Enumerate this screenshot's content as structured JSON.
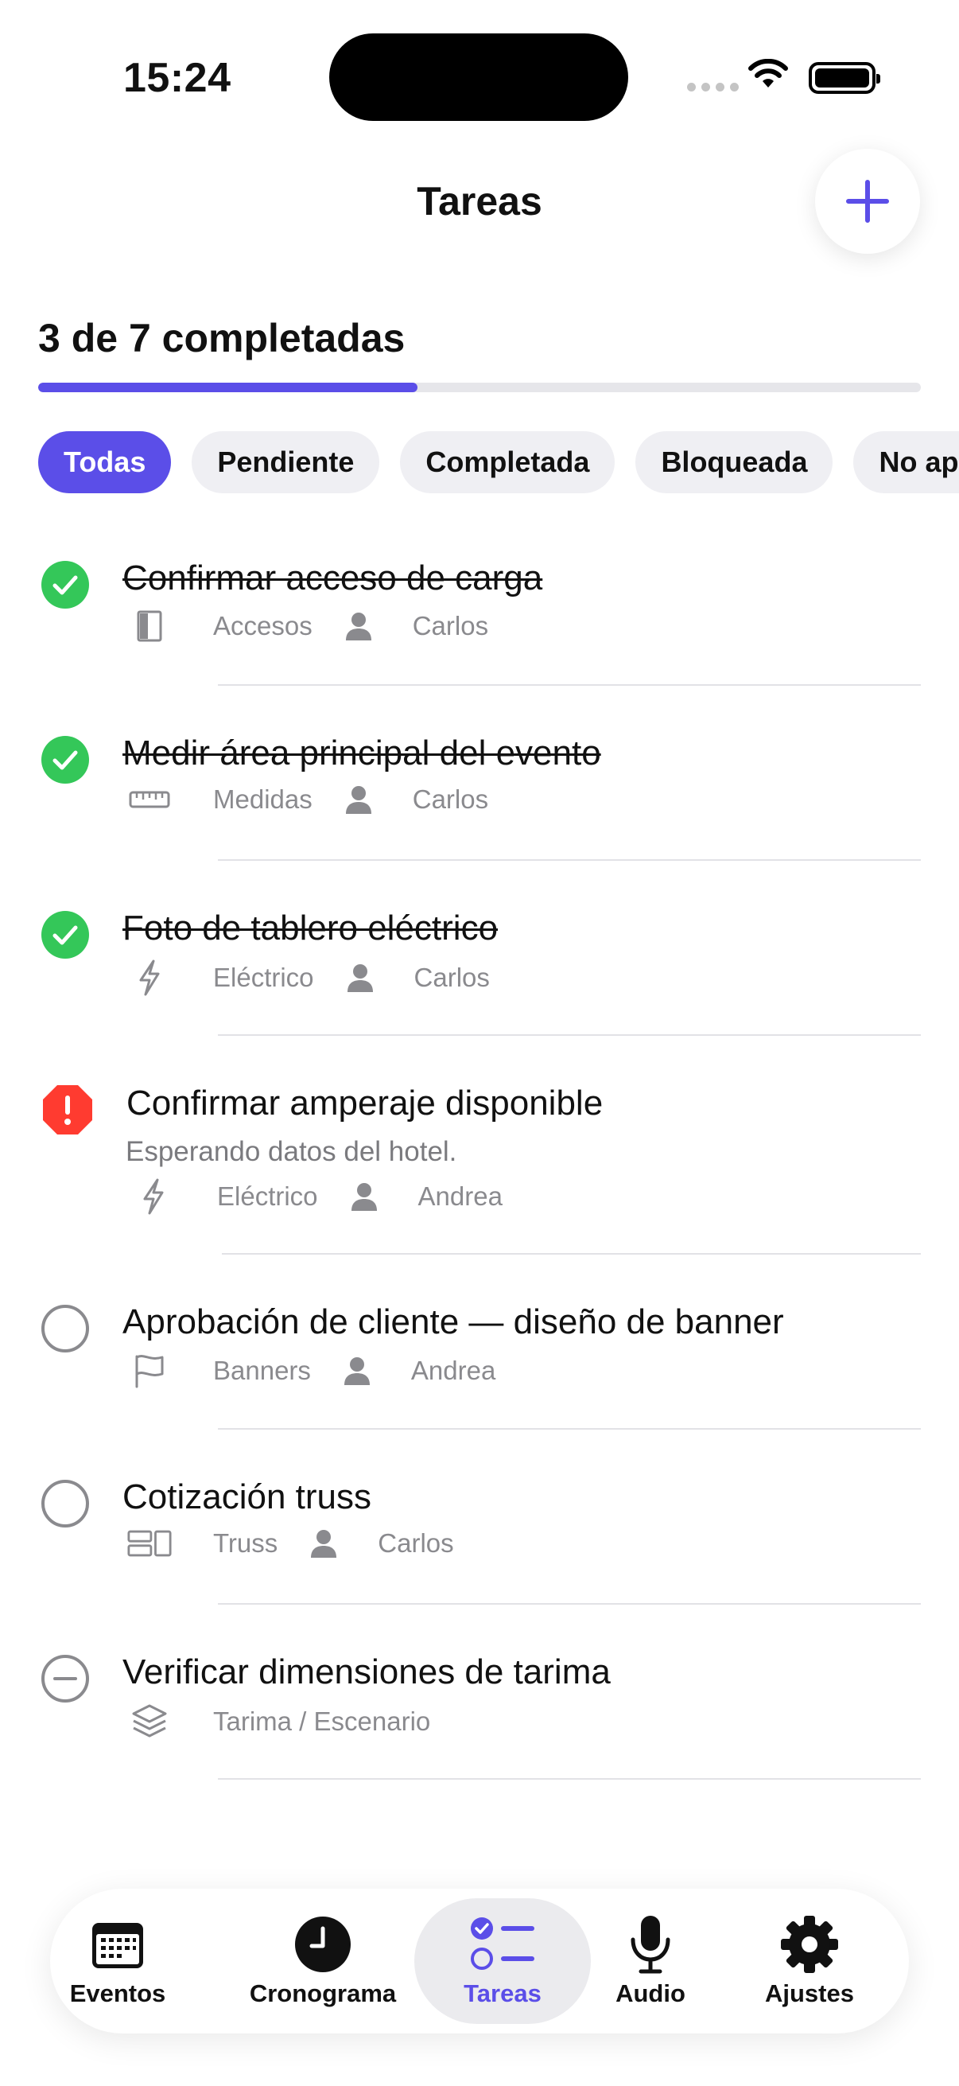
{
  "status_bar": {
    "time": "15:24"
  },
  "nav": {
    "title": "Tareas"
  },
  "progress": {
    "label": "3 de 7 completadas",
    "completed": 3,
    "total": 7,
    "fraction": 0.43
  },
  "filters": {
    "selected": "Todas",
    "chips": [
      "Todas",
      "Pendiente",
      "Completada",
      "Bloqueada",
      "No apl"
    ]
  },
  "tasks": [
    {
      "title": "Confirmar acceso de carga",
      "status": "completed",
      "category": "Accesos",
      "category_icon": "door-icon",
      "assignee": "Carlos"
    },
    {
      "title": "Medir área principal del evento",
      "status": "completed",
      "category": "Medidas",
      "category_icon": "ruler-icon",
      "assignee": "Carlos"
    },
    {
      "title": "Foto de tablero eléctrico",
      "status": "completed",
      "category": "Eléctrico",
      "category_icon": "bolt-icon",
      "assignee": "Carlos"
    },
    {
      "title": "Confirmar amperaje disponible",
      "status": "blocked",
      "note": "Esperando datos del hotel.",
      "category": "Eléctrico",
      "category_icon": "bolt-icon",
      "assignee": "Andrea"
    },
    {
      "title": "Aprobación de cliente — diseño de banner",
      "status": "pending",
      "category": "Banners",
      "category_icon": "flag-icon",
      "assignee": "Andrea"
    },
    {
      "title": "Cotización truss",
      "status": "pending",
      "category": "Truss",
      "category_icon": "truss-icon",
      "assignee": "Carlos"
    },
    {
      "title": "Verificar dimensiones de tarima",
      "status": "not-applicable",
      "category": "Tarima / Escenario",
      "category_icon": "layers-icon",
      "assignee": ""
    }
  ],
  "tab_bar": {
    "active": "Tareas",
    "tabs": [
      {
        "label": "Eventos",
        "icon": "calendar-icon"
      },
      {
        "label": "Cronograma",
        "icon": "clock-icon"
      },
      {
        "label": "Tareas",
        "icon": "checklist-icon"
      },
      {
        "label": "Audio",
        "icon": "microphone-icon"
      },
      {
        "label": "Ajustes",
        "icon": "gear-icon"
      }
    ]
  },
  "colors": {
    "accent": "#5b4ee8",
    "success": "#34c759",
    "danger": "#ff3b30",
    "secondary_text": "#8a8a8e"
  }
}
